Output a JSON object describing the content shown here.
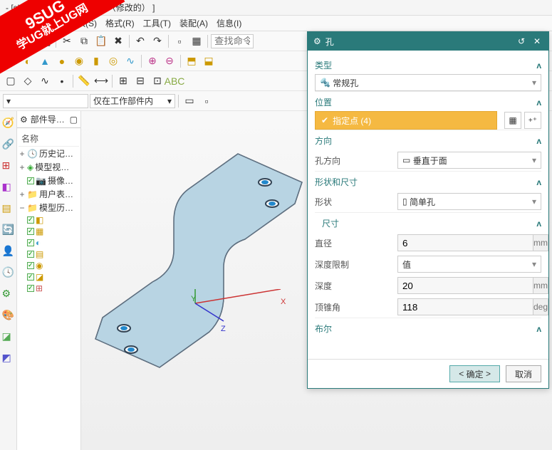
{
  "window": {
    "title": "- [sheet_metal_model2.prt （修改的） ]"
  },
  "watermark": {
    "line1": "9SUG",
    "line2": "学UG就上UG网"
  },
  "menu": {
    "view": "视图(V)",
    "insert": "插入(S)",
    "format": "格式(R)",
    "tool": "工具(T)",
    "assembly": "装配(A)",
    "info": "信息(I)"
  },
  "toolbar": {
    "search_ph": "查找命令",
    "filter": "仅在工作部件内"
  },
  "nav": {
    "header": "部件导…",
    "col": "名称",
    "nodes": {
      "history": "历史记…",
      "modelview": "模型视…",
      "camera": "摄像…",
      "userexp": "用户表…",
      "modelhist": "模型历…"
    }
  },
  "dialog": {
    "title": "孔",
    "sect_type": "类型",
    "type_value": "常规孔",
    "sect_pos": "位置",
    "pos_value": "指定点 (4)",
    "sect_dir": "方向",
    "dir_label": "孔方向",
    "dir_value": "垂直于面",
    "sect_shape": "形状和尺寸",
    "shape_label": "形状",
    "shape_value": "简单孔",
    "sect_dim": "尺寸",
    "diameter_label": "直径",
    "diameter_value": "6",
    "depthlimit_label": "深度限制",
    "depthlimit_value": "值",
    "depth_label": "深度",
    "depth_value": "20",
    "tipangle_label": "顶锥角",
    "tipangle_value": "118",
    "unit_mm": "mm",
    "unit_deg": "deg",
    "sect_bool": "布尔",
    "ok": "确定",
    "cancel": "取消"
  }
}
